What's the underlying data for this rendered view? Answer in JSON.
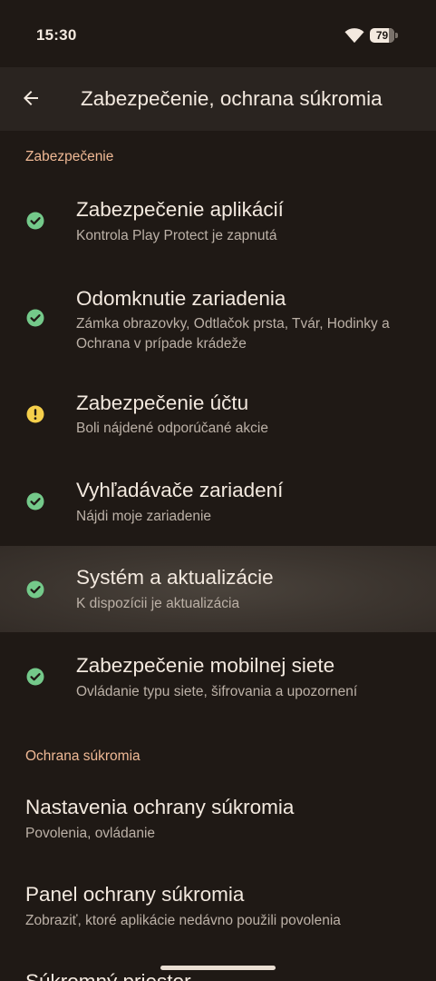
{
  "status_bar": {
    "time": "15:30",
    "battery_level": "79",
    "battery_percent": 79
  },
  "app_bar": {
    "title": "Zabezpečenie, ochrana súkromia",
    "back_icon": "arrow-back-icon"
  },
  "sections": {
    "security": {
      "header": "Zabezpečenie",
      "items": [
        {
          "title": "Zabezpečenie aplikácií",
          "subtitle": "Kontrola Play Protect je zapnutá",
          "status": "ok"
        },
        {
          "title": "Odomknutie zariadenia",
          "subtitle": "Zámka obrazovky, Odtlačok prsta, Tvár, Hodinky a Ochrana v prípade krádeže",
          "status": "ok"
        },
        {
          "title": "Zabezpečenie účtu",
          "subtitle": "Boli nájdené odporúčané akcie",
          "status": "warning"
        },
        {
          "title": "Vyhľadávače zariadení",
          "subtitle": "Nájdi moje zariadenie",
          "status": "ok"
        },
        {
          "title": "Systém a aktualizácie",
          "subtitle": "K dispozícii je aktualizácia",
          "status": "ok"
        },
        {
          "title": "Zabezpečenie mobilnej siete",
          "subtitle": "Ovládanie typu siete, šifrovania a upozornení",
          "status": "ok"
        }
      ]
    },
    "privacy": {
      "header": "Ochrana súkromia",
      "items": [
        {
          "title": "Nastavenia ochrany súkromia",
          "subtitle": "Povolenia, ovládanie"
        },
        {
          "title": "Panel ochrany súkromia",
          "subtitle": "Zobraziť, ktoré aplikácie nedávno použili povolenia"
        },
        {
          "title": "Súkromný priestor",
          "subtitle": ""
        }
      ]
    }
  },
  "colors": {
    "background": "#1f1915",
    "app_bar": "#2a2420",
    "accent_header": "#f0b995",
    "ok_green": "#74c98a",
    "warning_yellow": "#f5cf4b",
    "title_text": "#f3e9df",
    "subtitle_text": "#bcb1a7"
  }
}
